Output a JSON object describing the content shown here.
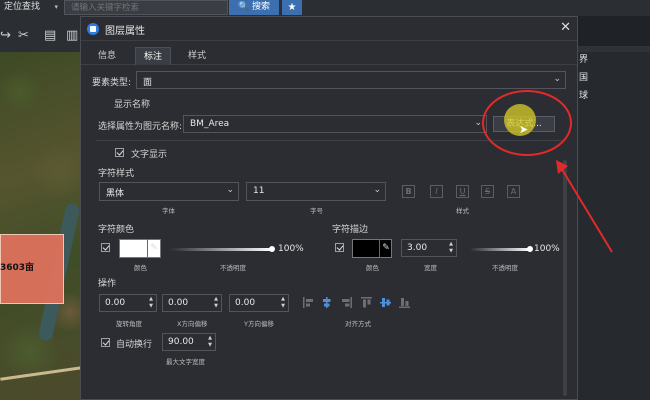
{
  "topbar": {
    "locate_label": "定位查找",
    "search_placeholder": "请输入关键字检索",
    "search_button": "搜索"
  },
  "map": {
    "parcel_label": "3603亩"
  },
  "right_panel": {
    "items": [
      "界",
      "国",
      "球"
    ]
  },
  "dialog": {
    "title": "图层属性",
    "tabs": [
      {
        "label": "信息",
        "active": false
      },
      {
        "label": "标注",
        "active": true
      },
      {
        "label": "样式",
        "active": false
      }
    ],
    "feature_type_label": "要素类型:",
    "feature_type_value": "面",
    "display_name_section": "显示名称",
    "select_attr_label": "选择属性为图元名称:",
    "select_attr_value": "BM_Area",
    "expression_button": "表达式...",
    "text_display_label": "文字显示",
    "char_style_section": "字符样式",
    "font_value": "黑体",
    "font_caption": "字体",
    "size_value": "11",
    "size_caption": "字号",
    "style_caption": "样式",
    "style_buttons": [
      "B",
      "I",
      "U",
      "S",
      "A"
    ],
    "char_color_section": "字符颜色",
    "color_caption": "颜色",
    "opacity_caption": "不透明度",
    "char_color_opacity": "100%",
    "char_stroke_section": "字符描边",
    "stroke_color_caption": "颜色",
    "stroke_width_value": "3.00",
    "stroke_width_caption": "宽度",
    "stroke_opacity_caption": "不透明度",
    "stroke_opacity": "100%",
    "operation_section": "操作",
    "rotation_value": "0.00",
    "rotation_caption": "旋转角度",
    "x_offset_value": "0.00",
    "x_offset_caption": "X方向偏移",
    "y_offset_value": "0.00",
    "y_offset_caption": "Y方向偏移",
    "align_caption": "对齐方式",
    "auto_wrap_label": "自动换行",
    "max_width_value": "90.00",
    "max_width_caption": "最大文字宽度"
  },
  "colors": {
    "char_color": "#ffffff",
    "stroke_color": "#000000",
    "accent": "#3c6fb0",
    "annotation_red": "#e22a2a"
  },
  "slider_levels": {
    "char_opacity": 1.0,
    "stroke_opacity": 1.0
  }
}
